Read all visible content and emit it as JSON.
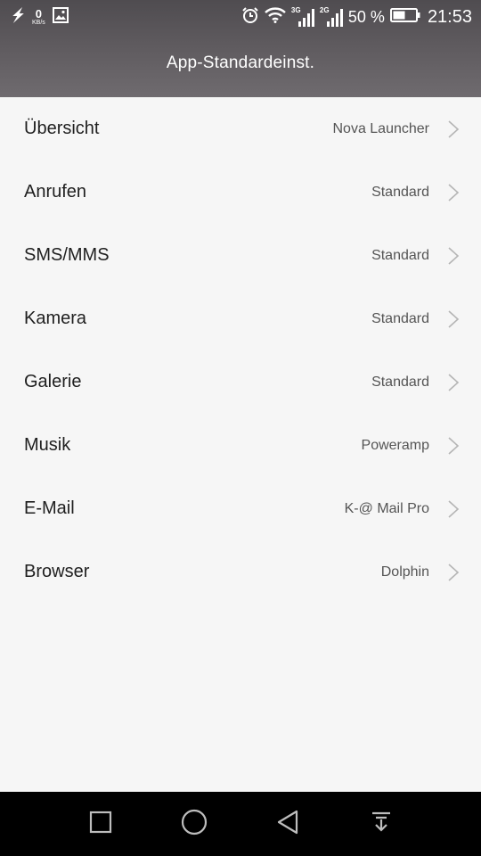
{
  "status_bar": {
    "net_speed_value": "0",
    "net_speed_unit": "KB/s",
    "sig1_tag": "3G",
    "sig2_tag": "2G",
    "battery_percent": "50 %",
    "time": "21:53",
    "icons": [
      "flash-icon",
      "image-icon",
      "alarm-icon",
      "wifi-icon",
      "signal-3g-icon",
      "signal-2g-icon",
      "battery-icon"
    ]
  },
  "header": {
    "title": "App-Standardeinst."
  },
  "rows": [
    {
      "label": "Übersicht",
      "value": "Nova Launcher"
    },
    {
      "label": "Anrufen",
      "value": "Standard"
    },
    {
      "label": "SMS/MMS",
      "value": "Standard"
    },
    {
      "label": "Kamera",
      "value": "Standard"
    },
    {
      "label": "Galerie",
      "value": "Standard"
    },
    {
      "label": "Musik",
      "value": "Poweramp"
    },
    {
      "label": "E-Mail",
      "value": "K-@ Mail Pro"
    },
    {
      "label": "Browser",
      "value": "Dolphin"
    }
  ],
  "nav": {
    "icons": [
      "recent-apps-icon",
      "home-icon",
      "back-icon",
      "notifications-pull-icon"
    ]
  },
  "colors": {
    "background": "#f6f6f6",
    "header": "#5e5a5e",
    "navbar": "#000000",
    "label": "#1f1f1f",
    "value": "#555555",
    "chevron": "#b5b5b5"
  }
}
